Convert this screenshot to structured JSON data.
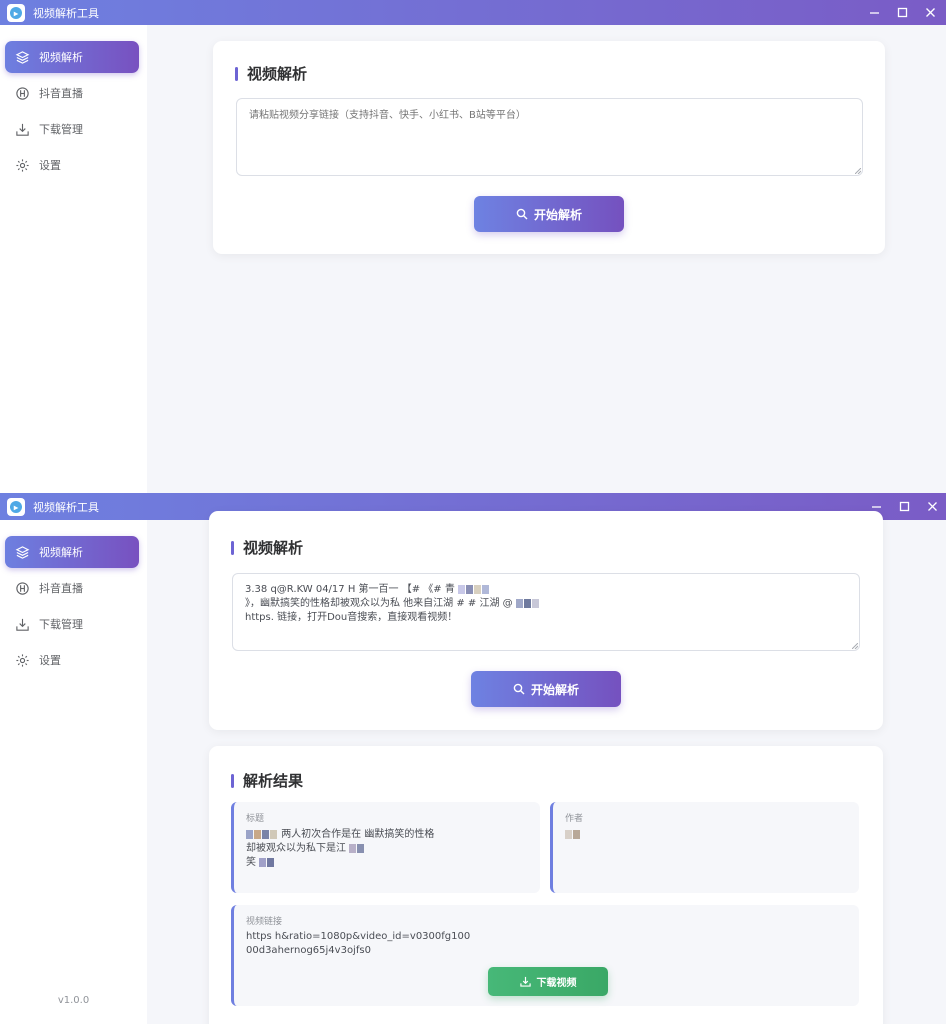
{
  "app": {
    "title": "视频解析工具"
  },
  "sidebar": {
    "items": [
      {
        "label": "视频解析",
        "icon": "layers-icon"
      },
      {
        "label": "抖音直播",
        "icon": "live-icon"
      },
      {
        "label": "下载管理",
        "icon": "download-icon"
      },
      {
        "label": "设置",
        "icon": "settings-icon"
      }
    ],
    "version": "v1.0.0"
  },
  "parse_panel": {
    "title": "视频解析",
    "placeholder": "请粘贴视频分享链接（支持抖音、快手、小红书、B站等平台）",
    "button_label": "开始解析"
  },
  "parse_panel_filled": {
    "input_line1": "3.38 q@R.KW 04/17 H 第一百一 【# 《# 青",
    "input_line2": "》，幽默搞笑的性格却被观众以为私 他来自江湖 # # 江湖 @",
    "input_line3": "https. 链接，打开Dou音搜索，直接观看视频！"
  },
  "result": {
    "title": "解析结果",
    "title_label": "标题",
    "title_line1": "两人初次合作是在 幽默搞笑的性格",
    "title_line2": "却被观众以为私下是江",
    "title_line3": "笑",
    "author_label": "作者",
    "link_label": "视频链接",
    "link_line1": "https h&ratio=1080p&video_id=v0300fg100",
    "link_line2": "00d3ahernog65j4v3ojfs0",
    "download_label": "下载视频"
  },
  "colors": {
    "accent_start": "#6e80e0",
    "accent_end": "#7851c0",
    "download_green": "#42b072"
  }
}
